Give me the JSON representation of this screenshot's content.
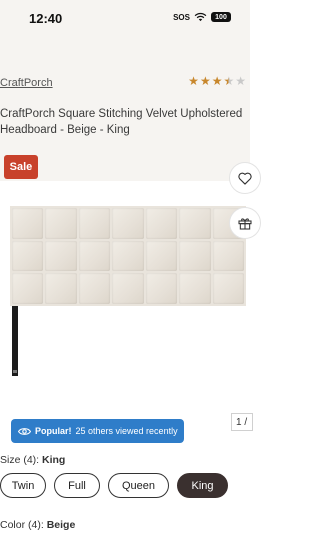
{
  "status_bar": {
    "time": "12:40",
    "sos": "SOS",
    "battery": "100"
  },
  "product": {
    "brand": "CraftPorch",
    "rating": 3.5,
    "rating_max": 5,
    "title": "CraftPorch Square Stitching Velvet Upholstered Headboard - Beige - King",
    "sale_badge": "Sale"
  },
  "gallery": {
    "counter": "1 /",
    "popular_strong": "Popular!",
    "popular_text": "25 others viewed recently"
  },
  "size": {
    "label_prefix": "Size (4):",
    "selected": "King",
    "options": [
      "Twin",
      "Full",
      "Queen",
      "King"
    ]
  },
  "color": {
    "label_prefix": "Color (4):",
    "selected": "Beige"
  },
  "icons": {
    "favorite": "heart-icon",
    "gift": "gift-icon",
    "eye": "eye-icon",
    "wifi": "wifi-icon"
  },
  "colors": {
    "accent_blue": "#2f7dc9",
    "sale_red": "#c8412b",
    "star": "#c8872c",
    "selected_chip": "#3a302f"
  }
}
